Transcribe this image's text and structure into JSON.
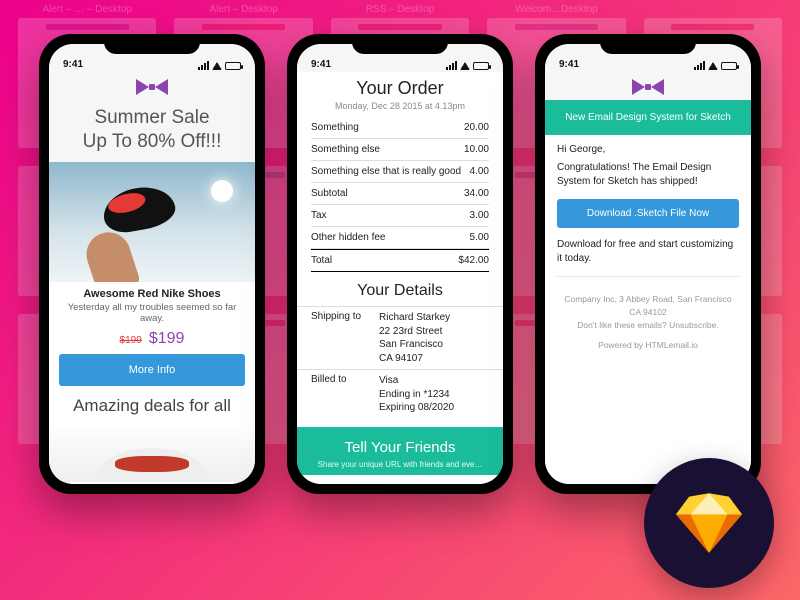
{
  "status": {
    "time": "9:41"
  },
  "bg_headers": [
    "Alert – … – Desktop",
    "Alert – Desktop",
    "RSS – Desktop",
    "Welcom…Desktop",
    ""
  ],
  "phone1": {
    "heroTitle": "Summer Sale\nUp To 80% Off!!!",
    "productTitle": "Awesome Red Nike Shoes",
    "productSubtitle": "Yesterday all my troubles seemed so far away.",
    "priceOld": "$199",
    "priceNew": "$199",
    "moreInfo": "More Info",
    "dealsTitle": "Amazing deals for all"
  },
  "phone2": {
    "title": "Your Order",
    "date": "Monday, Dec 28 2015 at 4.13pm",
    "rows": [
      {
        "label": "Something",
        "value": "20.00"
      },
      {
        "label": "Something else",
        "value": "10.00"
      },
      {
        "label": "Something else that is really good",
        "value": "4.00"
      },
      {
        "label": "Subtotal",
        "value": "34.00"
      },
      {
        "label": "Tax",
        "value": "3.00"
      },
      {
        "label": "Other hidden fee",
        "value": "5.00"
      }
    ],
    "totalLabel": "Total",
    "totalValue": "$42.00",
    "detailsTitle": "Your Details",
    "shippingLabel": "Shipping to",
    "shippingValue": "Richard Starkey\n22 23rd Street\nSan Francisco\nCA 94107",
    "billedLabel": "Billed to",
    "billedValue": "Visa\nEnding in *1234\nExpiring 08/2020",
    "tellTitle": "Tell Your Friends",
    "tellSub": "Share your unique URL with friends and eve…"
  },
  "phone3": {
    "banner": "New Email Design System for Sketch",
    "greeting": "Hi George,",
    "line1": "Congratulations! The Email Design System for Sketch has shipped!",
    "cta": "Download .Sketch File Now",
    "line2": "Download for free and start customizing it today.",
    "footer1": "Company Inc, 3 Abbey Road, San Francisco CA 94102",
    "footer2": "Don't like these emails? Unsubscribe.",
    "footer3": "Powered by HTMLemail.io"
  }
}
